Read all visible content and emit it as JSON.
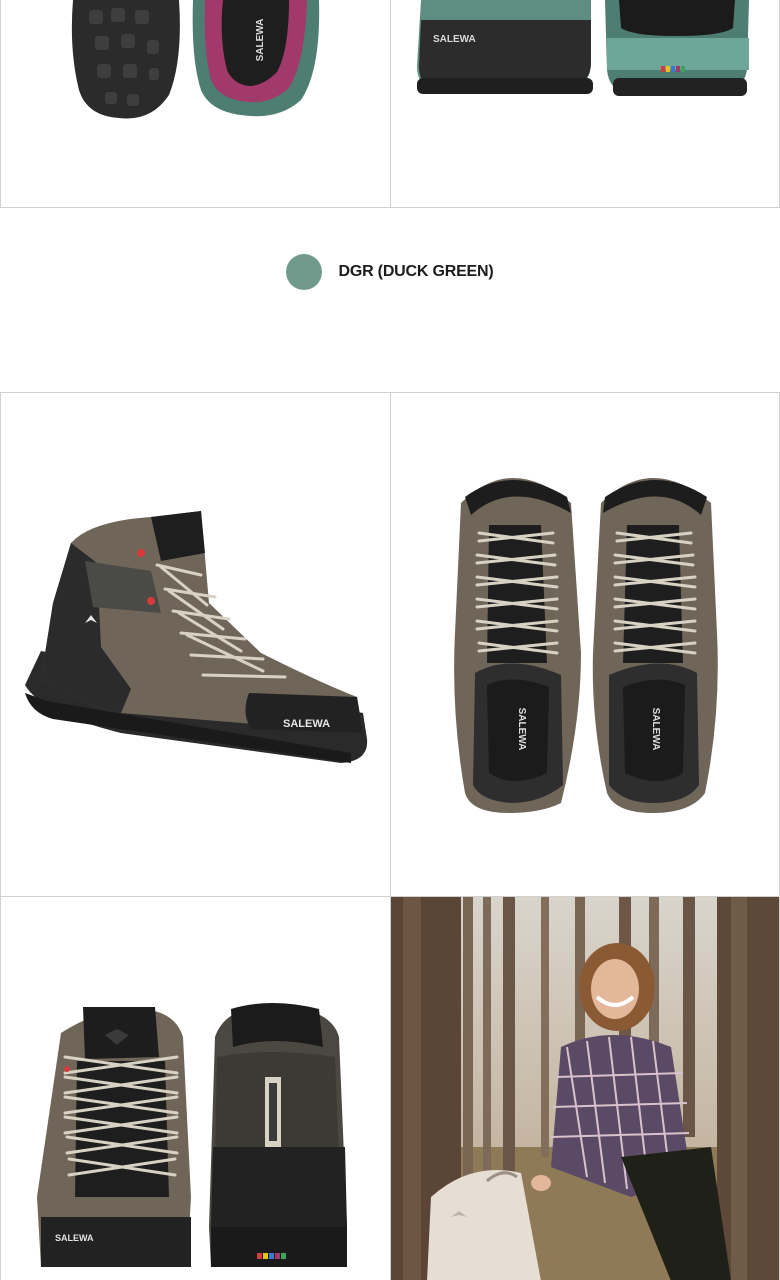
{
  "brand": "SALEWA",
  "color_option": {
    "code_label": "DGR (DUCK GREEN)",
    "swatch_color": "#6f9a8c"
  },
  "gallery": [
    {
      "name": "top-left",
      "subject": "green boot sole and pink lining"
    },
    {
      "name": "top-right",
      "subject": "green boot heel"
    },
    {
      "name": "side",
      "subject": "brown mid hiking boot side"
    },
    {
      "name": "top",
      "subject": "pair of boots from above"
    },
    {
      "name": "front-back",
      "subject": "boot front and back"
    },
    {
      "name": "lifestyle",
      "subject": "woman hiker in forest"
    }
  ],
  "colors": {
    "suede": "#6f6659",
    "rubber": "#2a2a2a",
    "lace": "#d8d2c4",
    "accent_red": "#d63a3a",
    "teal": "#4e7d72",
    "pink": "#a13a6a"
  }
}
